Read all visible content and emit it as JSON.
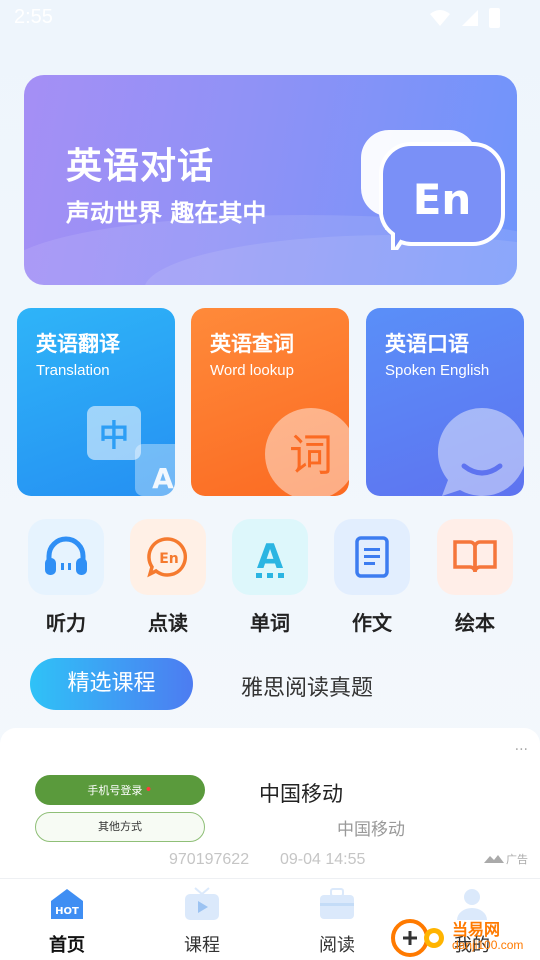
{
  "status_bar": {
    "time": "2:55"
  },
  "hero": {
    "title": "英语对话",
    "subtitle": "声动世界 趣在其中",
    "icon_text": "En",
    "icon": "speech-bubbles-icon"
  },
  "cards": [
    {
      "title": "英语翻译",
      "subtitle": "Translation",
      "icon": "translate-icon",
      "glyph1": "中",
      "glyph2": "A"
    },
    {
      "title": "英语查词",
      "subtitle": "Word lookup",
      "icon": "dictionary-search-icon",
      "glyph1": "词"
    },
    {
      "title": "英语口语",
      "subtitle": "Spoken English",
      "icon": "chat-bubble-icon"
    }
  ],
  "tools": [
    {
      "label": "听力",
      "icon": "headphones-icon",
      "bg": "#e6f3fe",
      "color": "#2f8ff5"
    },
    {
      "label": "点读",
      "icon": "en-bubble-icon",
      "bg": "#fff0e6",
      "color": "#f57a2f",
      "glyph": "En"
    },
    {
      "label": "单词",
      "icon": "letter-a-icon",
      "bg": "#ddf7fb",
      "color": "#2bb5e2",
      "glyph": "A"
    },
    {
      "label": "作文",
      "icon": "document-icon",
      "bg": "#e2eefe",
      "color": "#3c7cf0"
    },
    {
      "label": "绘本",
      "icon": "book-icon",
      "bg": "#ffeee8",
      "color": "#f5763b"
    }
  ],
  "tabs": [
    {
      "label": "精选课程",
      "active": true
    },
    {
      "label": "雅思阅读真题",
      "active": false
    }
  ],
  "ad": {
    "more": "···",
    "phone_login": "手机号登录",
    "other_method": "其他方式",
    "title": "中国移动",
    "subtitle": "中国移动",
    "number": "970197622",
    "time": "09-04 14:55",
    "label": "广告"
  },
  "bottom_nav": [
    {
      "label": "首页",
      "icon": "hot-home-icon",
      "badge": "HOT",
      "active": true
    },
    {
      "label": "课程",
      "icon": "tv-play-icon",
      "active": false
    },
    {
      "label": "阅读",
      "icon": "briefcase-icon",
      "active": false
    },
    {
      "label": "我的",
      "icon": "user-icon",
      "active": false
    }
  ],
  "watermark": {
    "title": "当易网",
    "url": "danji100.com"
  },
  "colors": {
    "accent_blue": "#4d7cf1",
    "accent_orange": "#fb6a22"
  }
}
